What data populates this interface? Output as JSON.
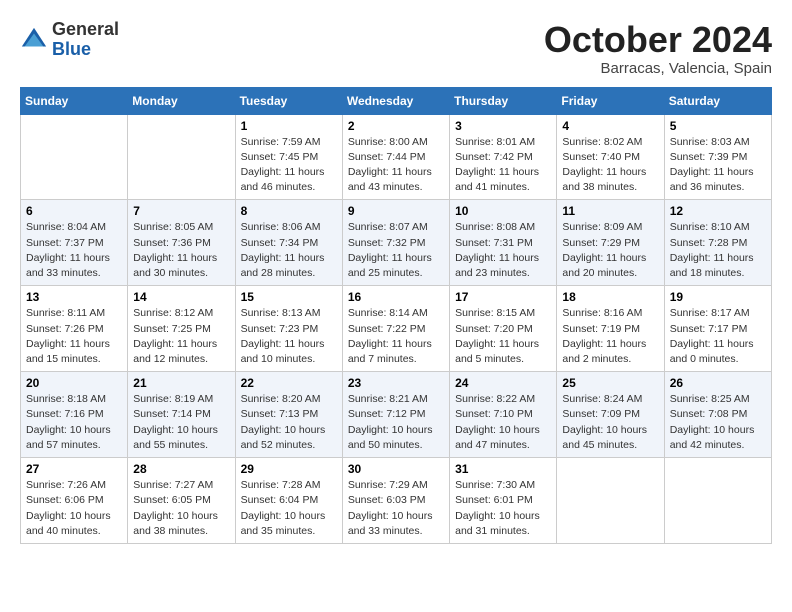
{
  "logo": {
    "general": "General",
    "blue": "Blue"
  },
  "title": "October 2024",
  "subtitle": "Barracas, Valencia, Spain",
  "headers": [
    "Sunday",
    "Monday",
    "Tuesday",
    "Wednesday",
    "Thursday",
    "Friday",
    "Saturday"
  ],
  "weeks": [
    [
      {
        "day": "",
        "detail": ""
      },
      {
        "day": "",
        "detail": ""
      },
      {
        "day": "1",
        "detail": "Sunrise: 7:59 AM\nSunset: 7:45 PM\nDaylight: 11 hours and 46 minutes."
      },
      {
        "day": "2",
        "detail": "Sunrise: 8:00 AM\nSunset: 7:44 PM\nDaylight: 11 hours and 43 minutes."
      },
      {
        "day": "3",
        "detail": "Sunrise: 8:01 AM\nSunset: 7:42 PM\nDaylight: 11 hours and 41 minutes."
      },
      {
        "day": "4",
        "detail": "Sunrise: 8:02 AM\nSunset: 7:40 PM\nDaylight: 11 hours and 38 minutes."
      },
      {
        "day": "5",
        "detail": "Sunrise: 8:03 AM\nSunset: 7:39 PM\nDaylight: 11 hours and 36 minutes."
      }
    ],
    [
      {
        "day": "6",
        "detail": "Sunrise: 8:04 AM\nSunset: 7:37 PM\nDaylight: 11 hours and 33 minutes."
      },
      {
        "day": "7",
        "detail": "Sunrise: 8:05 AM\nSunset: 7:36 PM\nDaylight: 11 hours and 30 minutes."
      },
      {
        "day": "8",
        "detail": "Sunrise: 8:06 AM\nSunset: 7:34 PM\nDaylight: 11 hours and 28 minutes."
      },
      {
        "day": "9",
        "detail": "Sunrise: 8:07 AM\nSunset: 7:32 PM\nDaylight: 11 hours and 25 minutes."
      },
      {
        "day": "10",
        "detail": "Sunrise: 8:08 AM\nSunset: 7:31 PM\nDaylight: 11 hours and 23 minutes."
      },
      {
        "day": "11",
        "detail": "Sunrise: 8:09 AM\nSunset: 7:29 PM\nDaylight: 11 hours and 20 minutes."
      },
      {
        "day": "12",
        "detail": "Sunrise: 8:10 AM\nSunset: 7:28 PM\nDaylight: 11 hours and 18 minutes."
      }
    ],
    [
      {
        "day": "13",
        "detail": "Sunrise: 8:11 AM\nSunset: 7:26 PM\nDaylight: 11 hours and 15 minutes."
      },
      {
        "day": "14",
        "detail": "Sunrise: 8:12 AM\nSunset: 7:25 PM\nDaylight: 11 hours and 12 minutes."
      },
      {
        "day": "15",
        "detail": "Sunrise: 8:13 AM\nSunset: 7:23 PM\nDaylight: 11 hours and 10 minutes."
      },
      {
        "day": "16",
        "detail": "Sunrise: 8:14 AM\nSunset: 7:22 PM\nDaylight: 11 hours and 7 minutes."
      },
      {
        "day": "17",
        "detail": "Sunrise: 8:15 AM\nSunset: 7:20 PM\nDaylight: 11 hours and 5 minutes."
      },
      {
        "day": "18",
        "detail": "Sunrise: 8:16 AM\nSunset: 7:19 PM\nDaylight: 11 hours and 2 minutes."
      },
      {
        "day": "19",
        "detail": "Sunrise: 8:17 AM\nSunset: 7:17 PM\nDaylight: 11 hours and 0 minutes."
      }
    ],
    [
      {
        "day": "20",
        "detail": "Sunrise: 8:18 AM\nSunset: 7:16 PM\nDaylight: 10 hours and 57 minutes."
      },
      {
        "day": "21",
        "detail": "Sunrise: 8:19 AM\nSunset: 7:14 PM\nDaylight: 10 hours and 55 minutes."
      },
      {
        "day": "22",
        "detail": "Sunrise: 8:20 AM\nSunset: 7:13 PM\nDaylight: 10 hours and 52 minutes."
      },
      {
        "day": "23",
        "detail": "Sunrise: 8:21 AM\nSunset: 7:12 PM\nDaylight: 10 hours and 50 minutes."
      },
      {
        "day": "24",
        "detail": "Sunrise: 8:22 AM\nSunset: 7:10 PM\nDaylight: 10 hours and 47 minutes."
      },
      {
        "day": "25",
        "detail": "Sunrise: 8:24 AM\nSunset: 7:09 PM\nDaylight: 10 hours and 45 minutes."
      },
      {
        "day": "26",
        "detail": "Sunrise: 8:25 AM\nSunset: 7:08 PM\nDaylight: 10 hours and 42 minutes."
      }
    ],
    [
      {
        "day": "27",
        "detail": "Sunrise: 7:26 AM\nSunset: 6:06 PM\nDaylight: 10 hours and 40 minutes."
      },
      {
        "day": "28",
        "detail": "Sunrise: 7:27 AM\nSunset: 6:05 PM\nDaylight: 10 hours and 38 minutes."
      },
      {
        "day": "29",
        "detail": "Sunrise: 7:28 AM\nSunset: 6:04 PM\nDaylight: 10 hours and 35 minutes."
      },
      {
        "day": "30",
        "detail": "Sunrise: 7:29 AM\nSunset: 6:03 PM\nDaylight: 10 hours and 33 minutes."
      },
      {
        "day": "31",
        "detail": "Sunrise: 7:30 AM\nSunset: 6:01 PM\nDaylight: 10 hours and 31 minutes."
      },
      {
        "day": "",
        "detail": ""
      },
      {
        "day": "",
        "detail": ""
      }
    ]
  ]
}
